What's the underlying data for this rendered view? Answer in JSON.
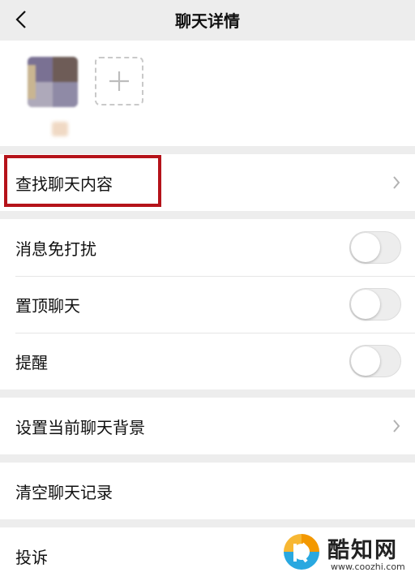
{
  "header": {
    "title": "聊天详情",
    "back_icon": "chevron-left-icon"
  },
  "members": {
    "add_icon": "plus-icon"
  },
  "settings": {
    "search": {
      "label": "查找聊天内容",
      "icon": "chevron-right-icon",
      "highlight_color": "#b5131a"
    },
    "toggles": [
      {
        "label": "消息免打扰",
        "on": false
      },
      {
        "label": "置顶聊天",
        "on": false
      },
      {
        "label": "提醒",
        "on": false
      }
    ],
    "background": {
      "label": "设置当前聊天背景",
      "icon": "chevron-right-icon"
    },
    "clear": {
      "label": "清空聊天记录"
    },
    "report": {
      "label": "投诉"
    }
  },
  "watermark": {
    "text": "酷知网",
    "url": "www.coozhi.com",
    "logo_colors": [
      "#f39800",
      "#29a8e0"
    ]
  },
  "colors": {
    "page_bg": "#ededed",
    "card_bg": "#ffffff",
    "text": "#111111"
  }
}
